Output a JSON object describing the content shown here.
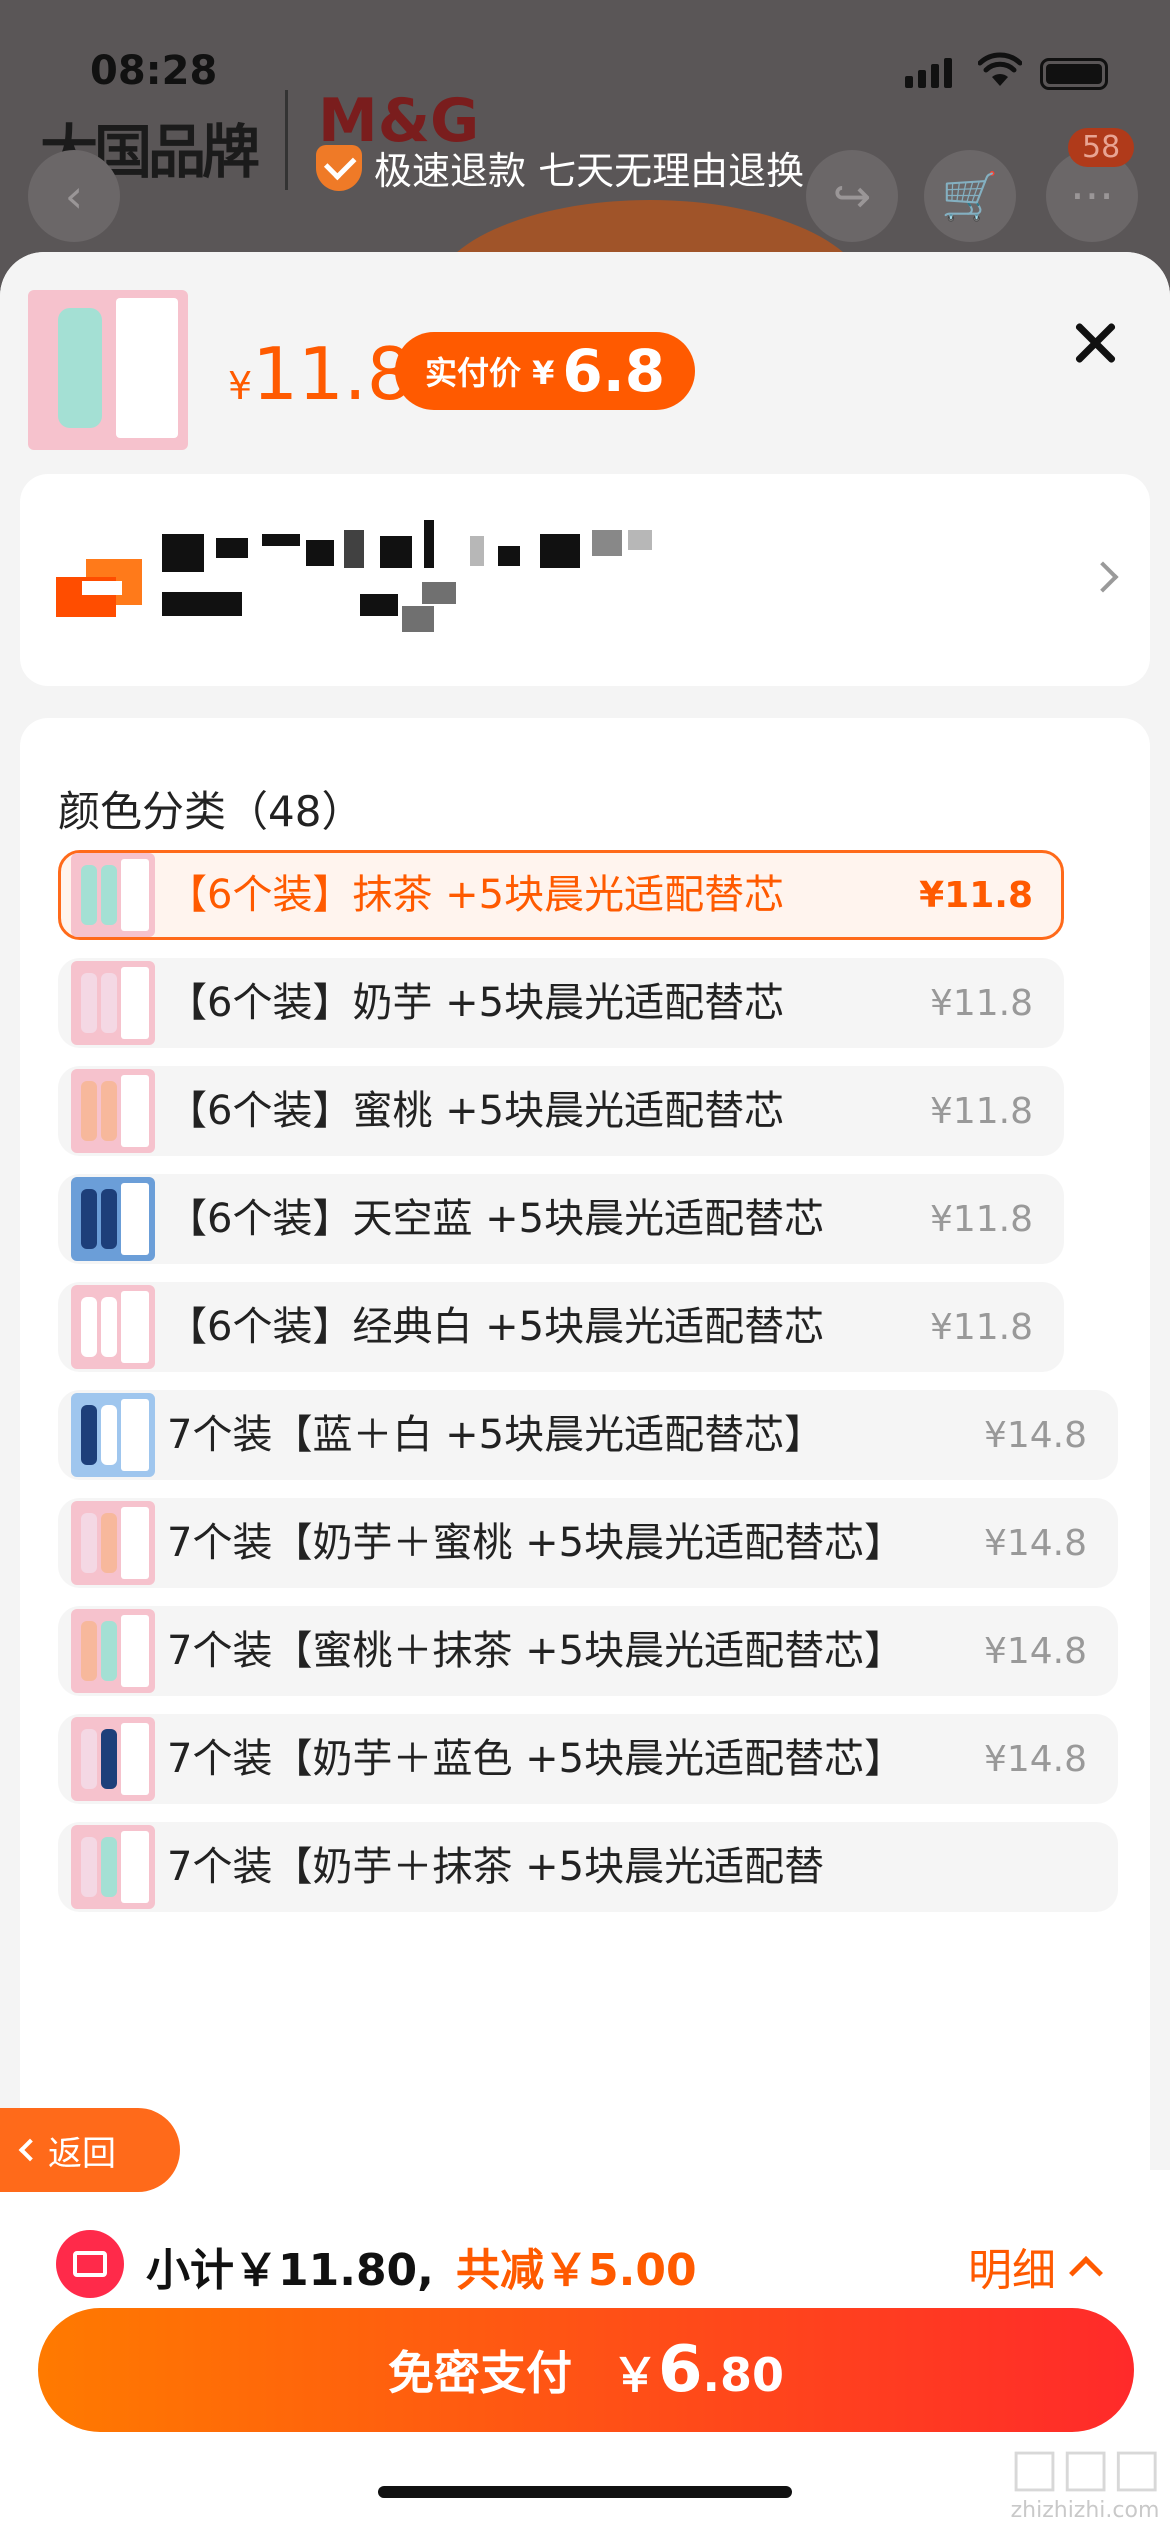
{
  "status_bar": {
    "time": "08:28"
  },
  "header": {
    "brand_logo": "大国品牌",
    "brand_mark": "M&G",
    "refund_text": "极速退款 七天无理由退换",
    "cart_badge": "58"
  },
  "product": {
    "currency": "¥",
    "price": "11.8",
    "real_price_label": "实付价 ¥",
    "real_price": "6.8"
  },
  "spec": {
    "title": "颜色分类（48）",
    "options": [
      {
        "label": "【6个装】抹茶 +5块晨光适配替芯",
        "price": "¥11.8",
        "selected": true,
        "c1": "#a4e0d4",
        "c2": "#a4e0d4",
        "bg": "#f6c2cd"
      },
      {
        "label": "【6个装】奶芋 +5块晨光适配替芯",
        "price": "¥11.8",
        "selected": false,
        "c1": "#f4d8e4",
        "c2": "#f4d8e4",
        "bg": "#f6c2cd"
      },
      {
        "label": "【6个装】蜜桃 +5块晨光适配替芯",
        "price": "¥11.8",
        "selected": false,
        "c1": "#f7b89c",
        "c2": "#f7b89c",
        "bg": "#f6c2cd"
      },
      {
        "label": "【6个装】天空蓝 +5块晨光适配替芯",
        "price": "¥11.8",
        "selected": false,
        "c1": "#1d3f7a",
        "c2": "#1d3f7a",
        "bg": "#6b9ed8"
      },
      {
        "label": "【6个装】经典白 +5块晨光适配替芯",
        "price": "¥11.8",
        "selected": false,
        "c1": "#ffffff",
        "c2": "#ffffff",
        "bg": "#f6c2cd"
      },
      {
        "label": "7个装【蓝＋白 +5块晨光适配替芯】",
        "price": "¥14.8",
        "selected": false,
        "c1": "#1d3f7a",
        "c2": "#ffffff",
        "bg": "#9fc6ee"
      },
      {
        "label": "7个装【奶芋＋蜜桃 +5块晨光适配替芯】",
        "price": "¥14.8",
        "selected": false,
        "c1": "#f4d8e4",
        "c2": "#f7b89c",
        "bg": "#f6c2cd"
      },
      {
        "label": "7个装【蜜桃＋抹茶 +5块晨光适配替芯】",
        "price": "¥14.8",
        "selected": false,
        "c1": "#f7b89c",
        "c2": "#a4e0d4",
        "bg": "#f6c2cd"
      },
      {
        "label": "7个装【奶芋＋蓝色 +5块晨光适配替芯】",
        "price": "¥14.8",
        "selected": false,
        "c1": "#f4d8e4",
        "c2": "#1d3f7a",
        "bg": "#f6c2cd"
      },
      {
        "label": "7个装【奶芋＋抹茶 +5块晨光适配替",
        "price": "",
        "selected": false,
        "c1": "#f4d8e4",
        "c2": "#a4e0d4",
        "bg": "#f6c2cd"
      }
    ]
  },
  "back_button": "返回",
  "bottom": {
    "subtotal": "小计￥11.80,",
    "discount": "共减￥5.00",
    "detail": "明细",
    "pay_label": "免密支付",
    "pay_currency": "￥",
    "pay_int": "6",
    "pay_dec": ".80"
  },
  "watermark": {
    "text": "zhizhizhi.com"
  },
  "colors": {
    "accent": "#ff5a00",
    "pay_gradient_start": "#ff7a00",
    "pay_gradient_end": "#ff2a2a"
  }
}
